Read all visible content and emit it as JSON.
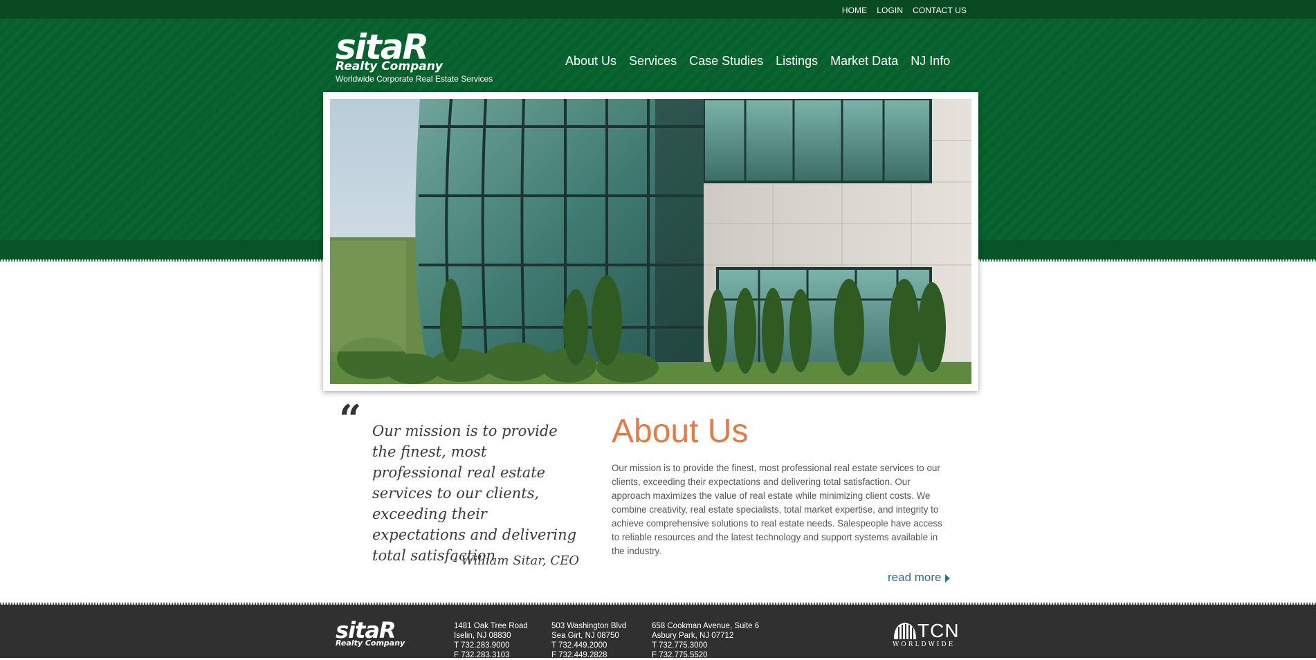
{
  "topbar": {
    "links": [
      "HOME",
      "LOGIN",
      "CONTACT US"
    ]
  },
  "brand": {
    "wordmark": "sitaR",
    "company": "Realty Company",
    "tagline": "Worldwide Corporate Real Estate Services"
  },
  "nav": {
    "items": [
      "About Us",
      "Services",
      "Case Studies",
      "Listings",
      "Market Data",
      "NJ Info"
    ]
  },
  "hero": {
    "image": "glass-office-building-photo"
  },
  "quote": {
    "mark": "“",
    "text": "Our mission is to provide the finest, most professional real estate services to our clients, exceeding their expectations and delivering total satisfaction",
    "author": "- William Sitar, CEO"
  },
  "about": {
    "title": "About Us",
    "body": "Our mission is to provide the finest, most professional real estate services to our clients, exceeding their expectations and delivering total satisfaction. Our approach maximizes the value of real estate while minimizing client costs. We combine creativity, real estate specialists, total market expertise, and integrity to achieve comprehensive solutions to real estate needs. Salespeople have access to reliable resources and the latest technology and support systems available in the industry.",
    "read_more": "read more"
  },
  "footer": {
    "offices": [
      {
        "street": "1481 Oak Tree Road",
        "city": "Iselin, NJ 08830",
        "phone": "T 732.283.9000",
        "fax": "F 732.283.3103"
      },
      {
        "street": "503 Washington Blvd",
        "city": "Sea Girt, NJ 08750",
        "phone": "T 732.449.2000",
        "fax": "F 732.449.2828"
      },
      {
        "street": "658 Cookman Avenue, Suite 6",
        "city": "Asbury Park, NJ 07712",
        "phone": "T 732.775.3000",
        "fax": "F 732.775.5520"
      }
    ],
    "partner": {
      "name": "TCN",
      "sub": "WORLDWIDE"
    }
  },
  "colors": {
    "header_green": "#075f2d",
    "topbar_green": "#0a4a23",
    "accent_orange": "#e17c46",
    "link_blue": "#2d6e8e",
    "footer_dark": "#303030"
  }
}
